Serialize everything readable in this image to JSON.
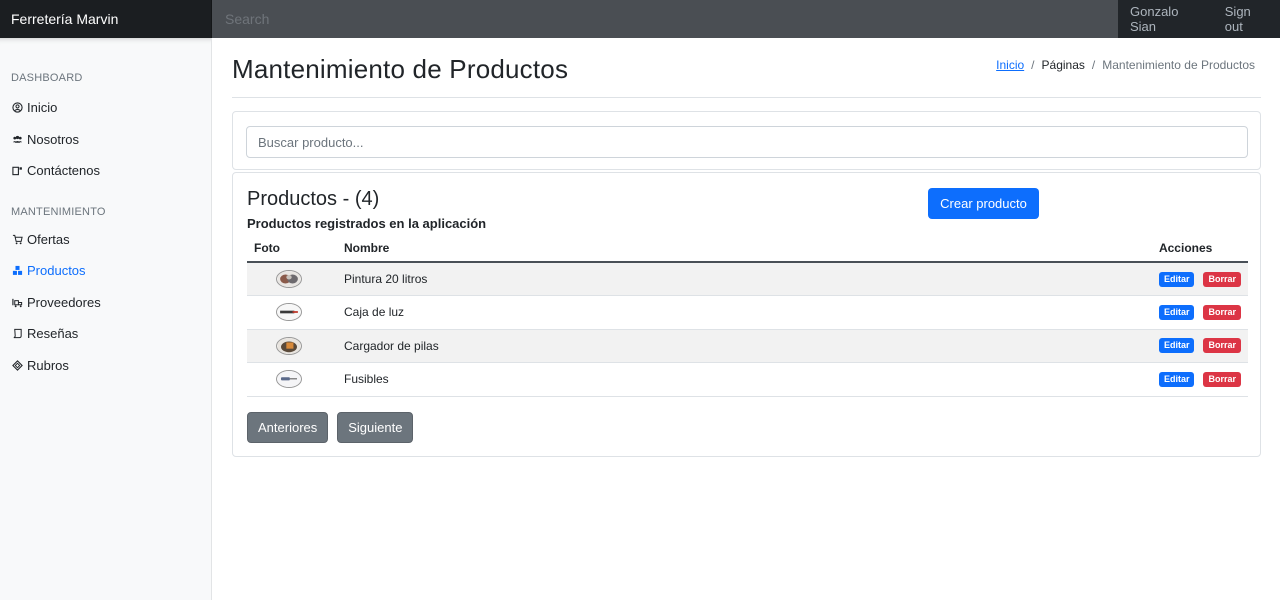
{
  "topbar": {
    "brand": "Ferretería Marvin",
    "search_placeholder": "Search",
    "user_name": "Gonzalo Sian",
    "signout": "Sign out"
  },
  "sidebar": {
    "heading_dashboard": "DASHBOARD",
    "dashboard_items": [
      {
        "label": "Inicio",
        "icon": "user-circle-icon"
      },
      {
        "label": "Nosotros",
        "icon": "users-icon"
      },
      {
        "label": "Contáctenos",
        "icon": "contact-icon"
      }
    ],
    "heading_mantenimiento": "MANTENIMIENTO",
    "mant_items": [
      {
        "label": "Ofertas",
        "icon": "cart-icon"
      },
      {
        "label": "Productos",
        "icon": "boxes-icon",
        "active": true
      },
      {
        "label": "Proveedores",
        "icon": "truck-icon"
      },
      {
        "label": "Reseñas",
        "icon": "review-icon"
      },
      {
        "label": "Rubros",
        "icon": "tag-icon"
      }
    ]
  },
  "page": {
    "title": "Mantenimiento de Productos",
    "breadcrumb": [
      "Inicio",
      "Páginas",
      "Mantenimiento de Productos"
    ]
  },
  "search": {
    "placeholder": "Buscar producto..."
  },
  "products": {
    "title": "Productos - (4)",
    "subtitle": "Productos registrados en la aplicación",
    "create_label": "Crear producto",
    "columns": [
      "Foto",
      "Nombre",
      "Acciones"
    ],
    "rows": [
      {
        "name": "Pintura 20 litros"
      },
      {
        "name": "Caja de luz"
      },
      {
        "name": "Cargador de pilas"
      },
      {
        "name": "Fusibles"
      }
    ],
    "edit_label": "Editar",
    "delete_label": "Borrar",
    "prev_label": "Anteriores",
    "next_label": "Siguiente"
  },
  "colors": {
    "primary": "#0d6efd",
    "danger": "#dc3545",
    "secondary": "#6c757d",
    "dark": "#212529"
  }
}
